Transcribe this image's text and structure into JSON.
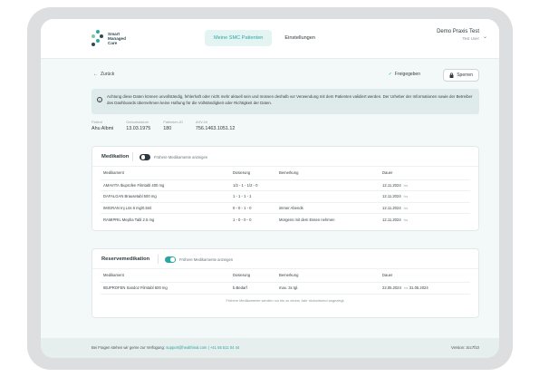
{
  "brand": {
    "line1": "Smart",
    "line2": "Managed",
    "line3": "Care"
  },
  "nav": {
    "tabs": [
      {
        "label": "Meine SMC Patienten"
      },
      {
        "label": "Einstellungen"
      }
    ]
  },
  "account": {
    "name": "Demo Praxis Test",
    "role": "Test User"
  },
  "actions": {
    "back": "Zurück",
    "released": "Freigegeben",
    "lock": "Sperren"
  },
  "warning": {
    "text": "Achtung diese Daten können unvollständig, fehlerhaft oder nicht mehr aktuell sein und müssen deshalb vor Verwendung mit dem Patienten validiert werden. Der Urheber der Informationen sowie der Betreiber des Dashboards übernehmen keine Haftung für die Vollständigkeit oder Richtigkeit der Daten."
  },
  "patient": {
    "fields": [
      {
        "label": "Patient",
        "value": "Ahu Albmi"
      },
      {
        "label": "Geburtsdatum",
        "value": "13.03.1975"
      },
      {
        "label": "Patienten-ID",
        "value": "180"
      },
      {
        "label": "AHV-Nr",
        "value": "756.1463.1051.12"
      }
    ]
  },
  "medication": {
    "title": "Medikation",
    "toggle_label": "Frühere Medikamente anzeigen",
    "toggle_on": false,
    "columns": [
      "Medikament",
      "Dosierung",
      "Bemerkung",
      "Dauer"
    ],
    "rows": [
      {
        "name": "AMAVITA Ibuprofen Filmtabl 400 mg",
        "dose": "1/2 - 1 - 1/2 - 0",
        "note": "",
        "start": "12.11.2024",
        "until": "bis"
      },
      {
        "name": "DAFALGAN Brausetabl 500 mg",
        "dose": "1 - 1 - 1 - 1",
        "note": "",
        "start": "12.11.2024",
        "until": "bis"
      },
      {
        "name": "IMIGRAN Inj Lös 6 mg/0.5ml",
        "dose": "0 - 0 - 1 - 0",
        "note": "immer Abends",
        "start": "12.11.2024",
        "until": "bis"
      },
      {
        "name": "RAMIPRIL Mepha Tabl 2.5 mg",
        "dose": "1 - 0 - 0 - 0",
        "note": "Morgens mit dem Essen nehmen",
        "start": "12.11.2024",
        "until": "bis"
      }
    ]
  },
  "reserve": {
    "title": "Reservemedikation",
    "toggle_label": "Frühere Medikamente anzeigen",
    "toggle_on": true,
    "columns": [
      "Medikament",
      "Dosierung",
      "Bemerkung",
      "Dauer"
    ],
    "rows": [
      {
        "name": "IBUPROFEN Sandoz Filmtabl 600 mg",
        "dose": "b.Bedarf",
        "note": "max. 3x tgl.",
        "start": "22.05.2024",
        "until": "bis",
        "end": "31.05.2024"
      }
    ],
    "note": "Frühere Medikamente werden nur bis zu einem Jahr rückwirkend angezeigt."
  },
  "footer": {
    "text": "Bei Fragen stehen wir gerne zur Verfügung:",
    "email": "support@healthinal.com",
    "phone": "| +41 55 511 04 44",
    "version": "Version: 3cc7f10"
  },
  "colors": {
    "accent": "#2aa7a3",
    "dark": "#2f3a3e",
    "background": "#f3f8f8"
  }
}
